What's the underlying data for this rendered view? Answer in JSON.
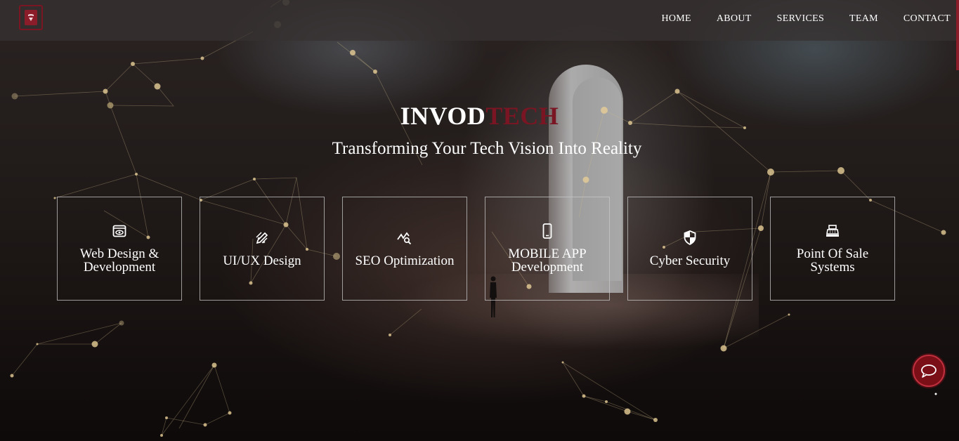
{
  "header": {
    "logo_alt": "logo",
    "nav": [
      {
        "label": "HOME"
      },
      {
        "label": "ABOUT"
      },
      {
        "label": "SERVICES"
      },
      {
        "label": "TEAM"
      },
      {
        "label": "CONTACT"
      }
    ]
  },
  "hero": {
    "brand_part1": "INVOD",
    "brand_part2": "TECH",
    "tagline": "Transforming Your Tech Vision Into Reality"
  },
  "services": [
    {
      "label": "Web Design & Development",
      "icon": "browser-eye-icon"
    },
    {
      "label": "UI/UX Design",
      "icon": "pen-ruler-icon"
    },
    {
      "label": "SEO Optimization",
      "icon": "chart-search-icon"
    },
    {
      "label": "MOBILE APP Development",
      "icon": "smartphone-icon"
    },
    {
      "label": "Cyber Security",
      "icon": "shield-icon"
    },
    {
      "label": "Point Of Sale Systems",
      "icon": "cash-register-icon"
    }
  ],
  "chat": {
    "icon": "chat-bubble-icon"
  },
  "colors": {
    "accent": "#7a1623",
    "text": "#ffffff",
    "navbar": "#373232"
  }
}
